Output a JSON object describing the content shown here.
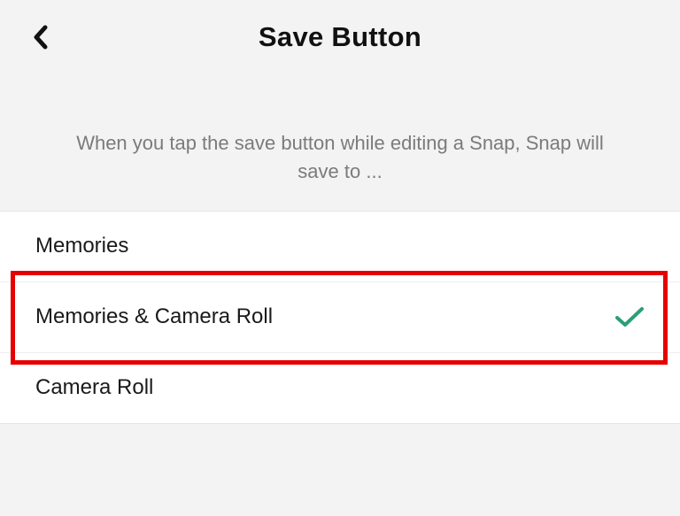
{
  "header": {
    "title": "Save Button"
  },
  "description": "When you tap the save button while editing a Snap, Snap will save to ...",
  "options": [
    {
      "label": "Memories",
      "selected": false
    },
    {
      "label": "Memories & Camera Roll",
      "selected": true
    },
    {
      "label": "Camera Roll",
      "selected": false
    }
  ],
  "colors": {
    "check": "#2b9e7a",
    "highlight_border": "#e60000"
  }
}
